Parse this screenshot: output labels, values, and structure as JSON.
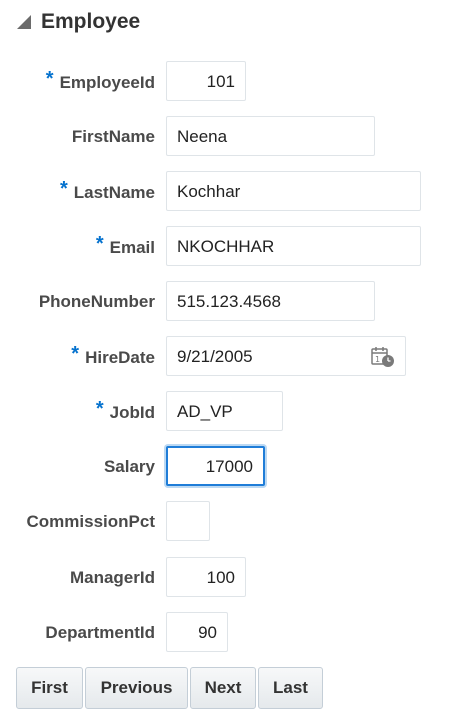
{
  "header": {
    "title": "Employee",
    "icon": "collapse-triangle-icon"
  },
  "form": {
    "required_marker": "*",
    "fields": [
      {
        "label": "EmployeeId",
        "value": "101",
        "required": true
      },
      {
        "label": "FirstName",
        "value": "Neena",
        "required": false
      },
      {
        "label": "LastName",
        "value": "Kochhar",
        "required": true
      },
      {
        "label": "Email",
        "value": "NKOCHHAR",
        "required": true
      },
      {
        "label": "PhoneNumber",
        "value": "515.123.4568",
        "required": false
      },
      {
        "label": "HireDate",
        "value": "9/21/2005",
        "required": true,
        "icon": "calendar-icon"
      },
      {
        "label": "JobId",
        "value": "AD_VP",
        "required": true
      },
      {
        "label": "Salary",
        "value": "17000",
        "required": false,
        "focused": true
      },
      {
        "label": "CommissionPct",
        "value": "",
        "required": false
      },
      {
        "label": "ManagerId",
        "value": "100",
        "required": false
      },
      {
        "label": "DepartmentId",
        "value": "90",
        "required": false
      }
    ]
  },
  "toolbar": {
    "first_label": "First",
    "previous_label": "Previous",
    "next_label": "Next",
    "last_label": "Last"
  },
  "colors": {
    "required_marker": "#0572ce",
    "focus_border": "#1f7dd8"
  }
}
